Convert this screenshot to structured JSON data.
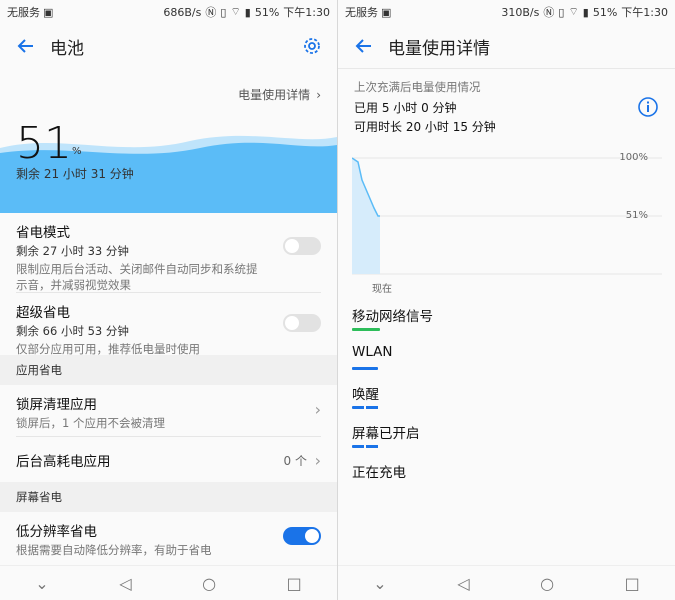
{
  "left": {
    "status": {
      "carrier": "无服务",
      "speed": "686B/s",
      "battery": "51%",
      "time": "下午1:30"
    },
    "title": "电池",
    "usage_link": "电量使用详情",
    "percent": "51",
    "percent_sign": "%",
    "remaining": "剩余 21 小时 31 分钟",
    "power_save": {
      "title": "省电模式",
      "remaining": "剩余 27 小时 33 分钟",
      "desc": "限制应用后台活动、关闭邮件自动同步和系统提示音，并减弱视觉效果",
      "enabled": false
    },
    "ultra_save": {
      "title": "超级省电",
      "remaining": "剩余 66 小时 53 分钟",
      "desc": "仅部分应用可用，推荐低电量时使用",
      "enabled": false
    },
    "app_section": "应用省电",
    "lock_clean": {
      "title": "锁屏清理应用",
      "desc": "锁屏后，1 个应用不会被清理"
    },
    "bg_apps": {
      "title": "后台高耗电应用",
      "count": "0 个"
    },
    "screen_section": "屏幕省电",
    "low_res": {
      "title": "低分辨率省电",
      "desc": "根据需要自动降低分辨率，有助于省电",
      "enabled": true
    }
  },
  "right": {
    "status": {
      "carrier": "无服务",
      "speed": "310B/s",
      "battery": "51%",
      "time": "下午1:30"
    },
    "title": "电量使用详情",
    "caption": "上次充满后电量使用情况",
    "used": "已用 5 小时 0 分钟",
    "available": "可用时长 20 小时 15 分钟",
    "chart_label_100": "100%",
    "chart_label_51": "51%",
    "chart_now": "现在",
    "items": [
      {
        "name": "移动网络信号",
        "bar_color": "#2dbd5a"
      },
      {
        "name": "WLAN",
        "bar_color": "#1a73e8"
      },
      {
        "name": "唤醒",
        "bar_color": "#1a73e8"
      },
      {
        "name": "屏幕已开启",
        "bar_color": "#1a73e8"
      },
      {
        "name": "正在充电",
        "bar_color": ""
      }
    ]
  },
  "colors": {
    "accent": "#1a73e8",
    "wave": "#5bbcf7",
    "green": "#2dbd5a"
  }
}
